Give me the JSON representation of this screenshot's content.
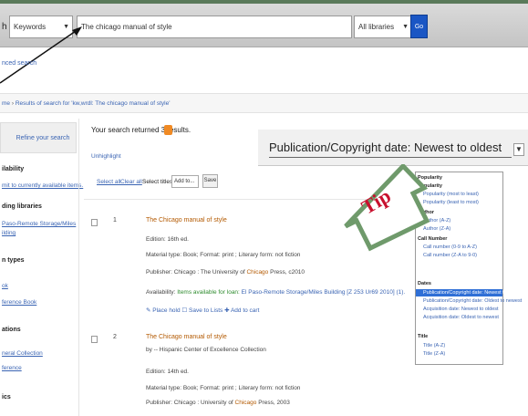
{
  "header": {
    "search_label_fragment": "h",
    "search_type": "Keywords",
    "query": "The chicago manual of style",
    "library": "All libraries",
    "go_label": "Go"
  },
  "advanced_search_fragment": "nced search",
  "breadcrumb": {
    "home_fragment": "me",
    "separator": "›",
    "results_label": "Results of search for 'kw,wrdl: The chicago manual of style'"
  },
  "sidebar": {
    "refine_label": "Refine your search",
    "items": [
      {
        "text": "ilability",
        "kind": "head"
      },
      {
        "text": "mit to currently available items.",
        "kind": "link"
      },
      {
        "text": "ding libraries",
        "kind": "head"
      },
      {
        "text": "Paso-Remote Storage/Miles",
        "kind": "link"
      },
      {
        "text": "ilding",
        "kind": "link"
      },
      {
        "text": "n types",
        "kind": "head"
      },
      {
        "text": "ok",
        "kind": "link"
      },
      {
        "text": "ference Book",
        "kind": "link"
      },
      {
        "text": "ations",
        "kind": "head"
      },
      {
        "text": "neral Collection",
        "kind": "link"
      },
      {
        "text": "ference",
        "kind": "link"
      },
      {
        "text": "ics",
        "kind": "head"
      }
    ]
  },
  "results": {
    "count_text": "Your search returned 3 results.",
    "unhighlight": "Unhighlight",
    "select_all": "Select all",
    "clear_all": "Clear all",
    "select_titles": "Select titles to:",
    "add_to": "Add to...",
    "save": "Save",
    "items": [
      {
        "num": "1",
        "title": "The Chicago manual of style",
        "edition": "Edition: 16th ed.",
        "material": "Material type: Book; Format: print ; Literary form: not fiction",
        "publisher_prefix": "Publisher: Chicago : The University of ",
        "publisher_hl": "Chicago",
        "publisher_suffix": " Press, c2010",
        "availability_prefix": "Availability: ",
        "availability_green": "Items available for loan:",
        "availability_suffix": " El Paso-Remote Storage/Miles Building [Z 253 Ur69 2010] (1).",
        "actions": "✎ Place hold   ☐ Save to Lists   ✚ Add to cart"
      },
      {
        "num": "2",
        "title": "The Chicago manual of style",
        "author": "by -- Hispanic Center of Excellence Collection",
        "edition": "Edition: 14th ed.",
        "material": "Material type: Book; Format: print ; Literary form: not fiction",
        "publisher_prefix": "Publisher: Chicago : University of ",
        "publisher_hl": "Chicago",
        "publisher_suffix": " Press, 2003"
      }
    ]
  },
  "sort": {
    "selected": "Publication/Copyright date: Newest to oldest",
    "groups": [
      {
        "label": "Popularity",
        "options": [
          "Popularity (most to least)",
          "Popularity (least to most)"
        ]
      },
      {
        "label": "Author",
        "options": [
          "Author (A-Z)",
          "Author (Z-A)"
        ]
      },
      {
        "label": "Call Number",
        "options": [
          "Call number (0-9 to A-Z)",
          "Call number (Z-A to 9-0)"
        ]
      },
      {
        "label": "Dates",
        "options": [
          "Publication/Copyright date: Newest to oldest",
          "Publication/Copyright date: Oldest to newest",
          "Acquisition date: Newest to oldest",
          "Acquisition date: Oldest to newest"
        ]
      },
      {
        "label": "Title",
        "options": [
          "Title (A-Z)",
          "Title (Z-A)"
        ]
      }
    ],
    "top_label": "Popularity"
  },
  "tip": {
    "label": "Tip",
    "colors": {
      "arrow_stroke": "#6f9a6b",
      "label": "#c8102e"
    }
  }
}
